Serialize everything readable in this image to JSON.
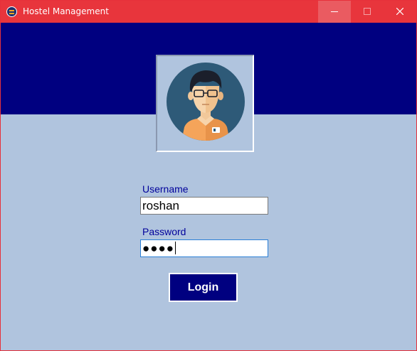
{
  "window": {
    "title": "Hostel Management",
    "icons": {
      "app": "app-icon",
      "minimize": "minimize-icon",
      "maximize": "maximize-icon",
      "close": "close-icon"
    },
    "colors": {
      "titlebar": "#e8353c",
      "header_band": "#000080",
      "form_background": "#b0c4de"
    }
  },
  "avatar": {
    "icon": "user-avatar-icon"
  },
  "form": {
    "username_label": "Username",
    "username_value": "roshan",
    "password_label": "Password",
    "password_mask": "●●●●",
    "login_label": "Login"
  }
}
